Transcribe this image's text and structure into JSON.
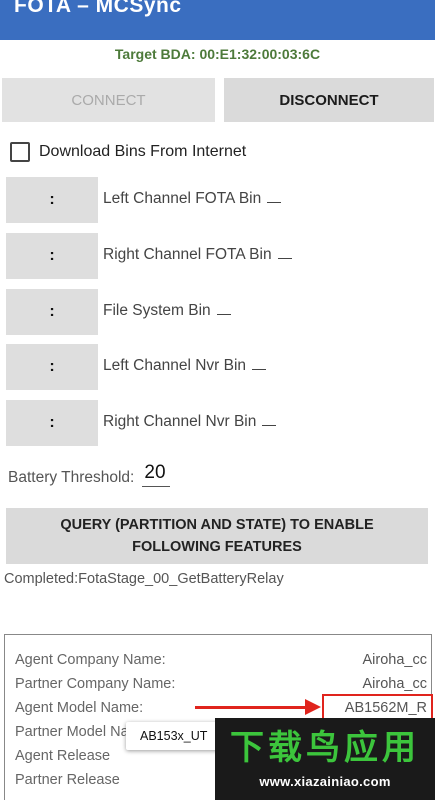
{
  "appbar": {
    "title": "FOTA – MCSync"
  },
  "target": {
    "text": "Target BDA: 00:E1:32:00:03:6C"
  },
  "buttons": {
    "connect": "CONNECT",
    "disconnect": "DISCONNECT",
    "query": "QUERY (PARTITION AND STATE) TO ENABLE FOLLOWING FEATURES"
  },
  "download": {
    "label": "Download Bins From Internet",
    "checked": false
  },
  "bins": [
    {
      "button": ":",
      "label": "Left Channel FOTA Bin"
    },
    {
      "button": ":",
      "label": "Right Channel FOTA Bin"
    },
    {
      "button": ":",
      "label": "File System Bin"
    },
    {
      "button": ":",
      "label": "Left Channel Nvr Bin"
    },
    {
      "button": ":",
      "label": "Right Channel Nvr Bin"
    }
  ],
  "battery": {
    "label": "Battery Threshold:",
    "value": "20"
  },
  "status": {
    "text": "Completed:FotaStage_00_GetBatteryRelay"
  },
  "info": [
    {
      "label": "Agent Company Name:",
      "value": "Airoha_cc"
    },
    {
      "label": "Partner Company Name:",
      "value": "Airoha_cc"
    },
    {
      "label": "Agent Model Name:",
      "value": "AB1562M_R"
    },
    {
      "label": "Partner Model Name:",
      "value": ""
    },
    {
      "label": "Agent Release",
      "value": ""
    },
    {
      "label": "Partner Release",
      "value": ""
    }
  ],
  "tooltip": {
    "text": "AB153x_UT"
  },
  "watermark": {
    "title": "下载鸟应用",
    "url": "www.xiazainiao.com"
  },
  "colors": {
    "appbar": "#3a6ec0",
    "target_text": "#4d7a3a",
    "highlight": "#e0241d",
    "watermark_green": "#3cc53c"
  }
}
